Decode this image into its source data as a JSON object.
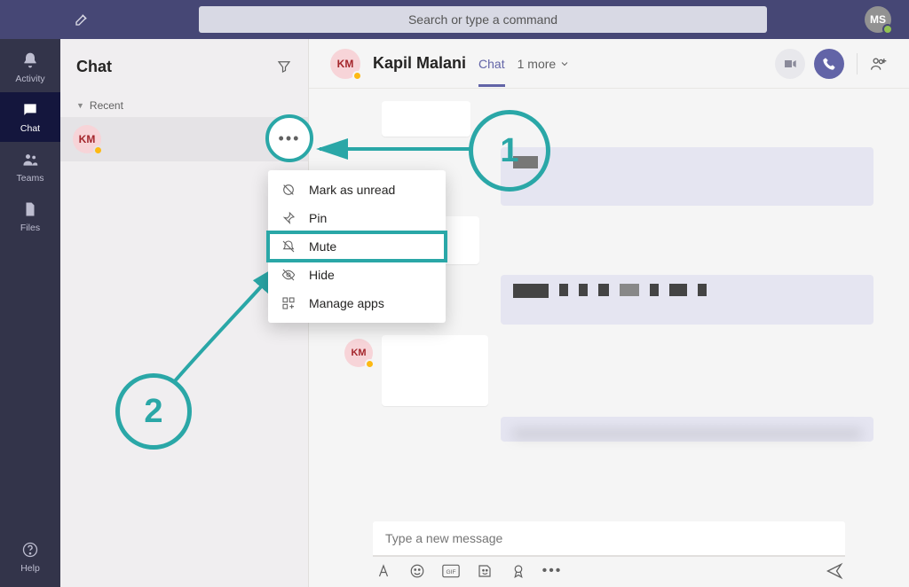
{
  "top": {
    "search_placeholder": "Search or type a command",
    "me_initials": "MS"
  },
  "rail": {
    "activity": "Activity",
    "chat": "Chat",
    "teams": "Teams",
    "files": "Files",
    "help": "Help"
  },
  "chatlist": {
    "title": "Chat",
    "section_recent": "Recent",
    "contact_initials": "KM"
  },
  "contextMenu": {
    "mark_unread": "Mark as unread",
    "pin": "Pin",
    "mute": "Mute",
    "hide": "Hide",
    "manage_apps": "Manage apps"
  },
  "chatHeader": {
    "initials": "KM",
    "name": "Kapil Malani",
    "tab_chat": "Chat",
    "more_tabs": "1 more"
  },
  "compose": {
    "placeholder": "Type a new message"
  },
  "annotations": {
    "one": "1",
    "two": "2"
  }
}
